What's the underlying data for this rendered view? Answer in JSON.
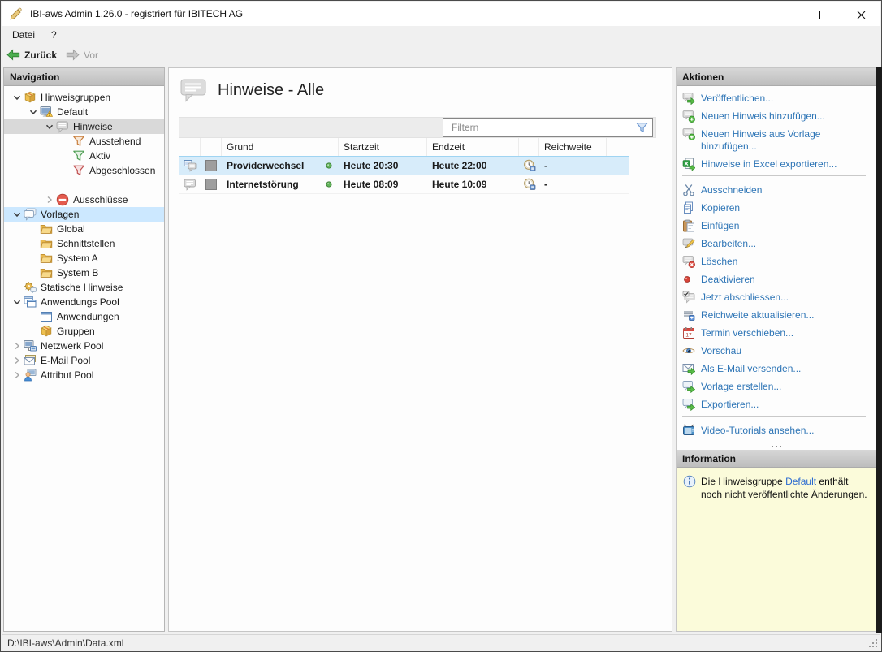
{
  "window": {
    "title": "IBI-aws Admin 1.26.0 - registriert für IBITECH AG"
  },
  "menu": {
    "items": [
      {
        "label": "Datei"
      },
      {
        "label": "?"
      }
    ]
  },
  "toolbar": {
    "back_label": "Zurück",
    "forward_label": "Vor"
  },
  "navigation": {
    "header": "Navigation",
    "tree": [
      {
        "label": "Hinweisgruppen",
        "level": 0,
        "icon": "package-icon",
        "expander": "down"
      },
      {
        "label": "Default",
        "level": 1,
        "icon": "monitor-warning-icon",
        "expander": "down"
      },
      {
        "label": "Hinweise",
        "level": 2,
        "icon": "bubble-icon",
        "expander": "down",
        "selected": "gray"
      },
      {
        "label": "Ausstehend",
        "level": 3,
        "icon": "funnel-orange-icon"
      },
      {
        "label": "Aktiv",
        "level": 3,
        "icon": "funnel-green-icon"
      },
      {
        "label": "Abgeschlossen",
        "level": 3,
        "icon": "funnel-red-icon"
      },
      {
        "spacer": true
      },
      {
        "label": "Ausschlüsse",
        "level": 2,
        "icon": "no-entry-icon",
        "expander": "right"
      },
      {
        "label": "Vorlagen",
        "level": 0,
        "icon": "bubbles-icon",
        "expander": "down",
        "selected": "blue"
      },
      {
        "label": "Global",
        "level": 1,
        "icon": "folder-icon"
      },
      {
        "label": "Schnittstellen",
        "level": 1,
        "icon": "folder-icon"
      },
      {
        "label": "System A",
        "level": 1,
        "icon": "folder-icon"
      },
      {
        "label": "System B",
        "level": 1,
        "icon": "folder-icon"
      },
      {
        "label": "Statische Hinweise",
        "level": 0,
        "icon": "gear-bubble-icon"
      },
      {
        "label": "Anwendungs Pool",
        "level": 0,
        "icon": "windows-icon",
        "expander": "down"
      },
      {
        "label": "Anwendungen",
        "level": 1,
        "icon": "window-icon"
      },
      {
        "label": "Gruppen",
        "level": 1,
        "icon": "package-icon"
      },
      {
        "label": "Netzwerk Pool",
        "level": 0,
        "icon": "network-icon",
        "expander": "right"
      },
      {
        "label": "E-Mail Pool",
        "level": 0,
        "icon": "mail-icon",
        "expander": "right"
      },
      {
        "label": "Attribut Pool",
        "level": 0,
        "icon": "person-icon",
        "expander": "right"
      }
    ]
  },
  "main": {
    "title": "Hinweise - Alle",
    "filter_placeholder": "Filtern",
    "table": {
      "columns": [
        "",
        "",
        "Grund",
        "",
        "Startzeit",
        "Endzeit",
        "",
        "Reichweite"
      ],
      "rows": [
        {
          "type_icon": "bubble-monitor-icon",
          "color_icon": "gray-square-icon",
          "grund": "Providerwechsel",
          "status": "green",
          "startzeit": "Heute 20:30",
          "endzeit": "Heute 22:00",
          "reach_icon": "clock-icon",
          "reichweite": "-",
          "selected": true
        },
        {
          "type_icon": "bubble-icon",
          "color_icon": "gray-square-icon",
          "grund": "Internetstörung",
          "status": "green",
          "startzeit": "Heute 08:09",
          "endzeit": "Heute 10:09",
          "reach_icon": "clock-icon",
          "reichweite": "-",
          "selected": false
        }
      ]
    }
  },
  "actions": {
    "header": "Aktionen",
    "items": [
      {
        "label": "Veröffentlichen...",
        "icon": "publish-icon"
      },
      {
        "label": "Neuen Hinweis hinzufügen...",
        "icon": "add-hint-icon"
      },
      {
        "label": "Neuen Hinweis aus Vorlage hinzufügen...",
        "icon": "add-hint-icon"
      },
      {
        "label": "Hinweise in Excel exportieren...",
        "icon": "excel-export-icon"
      },
      {
        "separator": true
      },
      {
        "label": "Ausschneiden",
        "icon": "cut-icon"
      },
      {
        "label": "Kopieren",
        "icon": "copy-icon"
      },
      {
        "label": "Einfügen",
        "icon": "paste-icon"
      },
      {
        "label": "Bearbeiten...",
        "icon": "edit-icon"
      },
      {
        "label": "Löschen",
        "icon": "delete-icon"
      },
      {
        "label": "Deaktivieren",
        "icon": "deactivate-icon"
      },
      {
        "label": "Jetzt abschliessen...",
        "icon": "finish-icon"
      },
      {
        "label": "Reichweite aktualisieren...",
        "icon": "reach-update-icon"
      },
      {
        "label": "Termin verschieben...",
        "icon": "calendar-icon"
      },
      {
        "label": "Vorschau",
        "icon": "eye-icon"
      },
      {
        "label": "Als E-Mail versenden...",
        "icon": "send-mail-icon"
      },
      {
        "label": "Vorlage erstellen...",
        "icon": "create-template-icon"
      },
      {
        "label": "Exportieren...",
        "icon": "export-icon"
      },
      {
        "separator": true
      },
      {
        "label": "Video-Tutorials ansehen...",
        "icon": "tv-icon"
      },
      {
        "overflow": true
      }
    ]
  },
  "information": {
    "header": "Information",
    "text_before": "Die Hinweisgruppe ",
    "link": "Default",
    "text_after": " enthält noch nicht veröffentlichte Änderungen."
  },
  "statusbar": {
    "path": "D:\\IBI-aws\\Admin\\Data.xml"
  },
  "colors": {
    "link_blue": "#2e75b6",
    "tree_selection_blue": "#cce8ff",
    "tree_selection_gray": "#d9d9d9",
    "row_selection_blue": "#d7ecfa",
    "info_background": "#fbfbda",
    "status_green": "#62b45a",
    "back_arrow_green": "#4caf50"
  }
}
